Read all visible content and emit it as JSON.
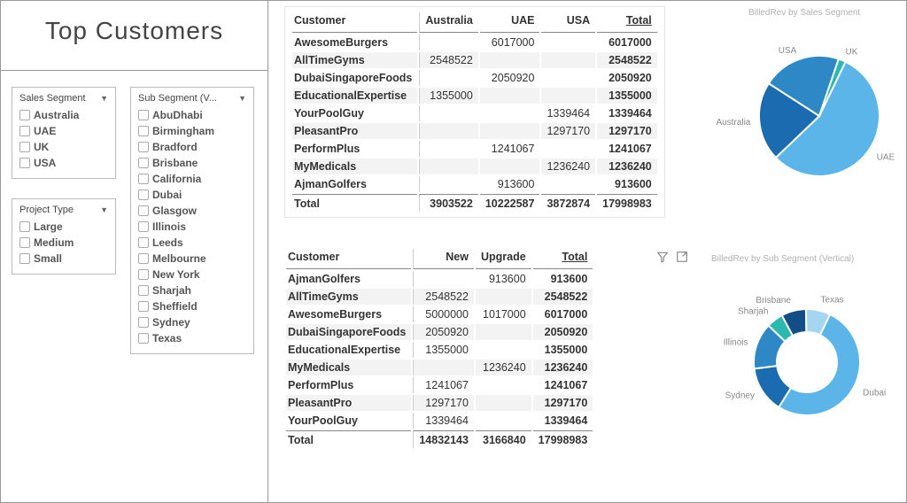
{
  "title": "Top  Customers",
  "slicers": {
    "sales_segment": {
      "header": "Sales Segment",
      "items": [
        "Australia",
        "UAE",
        "UK",
        "USA"
      ]
    },
    "project_type": {
      "header": "Project Type",
      "items": [
        "Large",
        "Medium",
        "Small"
      ]
    },
    "sub_segment": {
      "header": "Sub Segment (V...",
      "items": [
        "AbuDhabi",
        "Birmingham",
        "Bradford",
        "Brisbane",
        "California",
        "Dubai",
        "Glasgow",
        "Illinois",
        "Leeds",
        "Melbourne",
        "New York",
        "Sharjah",
        "Sheffield",
        "Sydney",
        "Texas"
      ]
    }
  },
  "matrix_top": {
    "header_customer": "Customer",
    "cols": [
      "Australia",
      "UAE",
      "USA",
      "Total"
    ],
    "rows": [
      {
        "c": "AwesomeBurgers",
        "v": [
          "",
          "6017000",
          "",
          "6017000"
        ]
      },
      {
        "c": "AllTimeGyms",
        "v": [
          "2548522",
          "",
          "",
          "2548522"
        ]
      },
      {
        "c": "DubaiSingaporeFoods",
        "v": [
          "",
          "2050920",
          "",
          "2050920"
        ]
      },
      {
        "c": "EducationalExpertise",
        "v": [
          "1355000",
          "",
          "",
          "1355000"
        ]
      },
      {
        "c": "YourPoolGuy",
        "v": [
          "",
          "",
          "1339464",
          "1339464"
        ]
      },
      {
        "c": "PleasantPro",
        "v": [
          "",
          "",
          "1297170",
          "1297170"
        ]
      },
      {
        "c": "PerformPlus",
        "v": [
          "",
          "1241067",
          "",
          "1241067"
        ]
      },
      {
        "c": "MyMedicals",
        "v": [
          "",
          "",
          "1236240",
          "1236240"
        ]
      },
      {
        "c": "AjmanGolfers",
        "v": [
          "",
          "913600",
          "",
          "913600"
        ]
      }
    ],
    "total_label": "Total",
    "totals": [
      "3903522",
      "10222587",
      "3872874",
      "17998983"
    ]
  },
  "matrix_bottom": {
    "header_customer": "Customer",
    "cols": [
      "New",
      "Upgrade",
      "Total"
    ],
    "rows": [
      {
        "c": "AjmanGolfers",
        "v": [
          "",
          "913600",
          "913600"
        ]
      },
      {
        "c": "AllTimeGyms",
        "v": [
          "2548522",
          "",
          "2548522"
        ]
      },
      {
        "c": "AwesomeBurgers",
        "v": [
          "5000000",
          "1017000",
          "6017000"
        ]
      },
      {
        "c": "DubaiSingaporeFoods",
        "v": [
          "2050920",
          "",
          "2050920"
        ]
      },
      {
        "c": "EducationalExpertise",
        "v": [
          "1355000",
          "",
          "1355000"
        ]
      },
      {
        "c": "MyMedicals",
        "v": [
          "",
          "1236240",
          "1236240"
        ]
      },
      {
        "c": "PerformPlus",
        "v": [
          "1241067",
          "",
          "1241067"
        ]
      },
      {
        "c": "PleasantPro",
        "v": [
          "1297170",
          "",
          "1297170"
        ]
      },
      {
        "c": "YourPoolGuy",
        "v": [
          "1339464",
          "",
          "1339464"
        ]
      }
    ],
    "total_label": "Total",
    "totals": [
      "14832143",
      "3166840",
      "17998983"
    ]
  },
  "chart_titles": {
    "pie1": "BilledRev by Sales Segment",
    "pie2": "BilledRev by Sub Segment (Vertical)"
  },
  "chart_data": [
    {
      "type": "pie",
      "title": "BilledRev by Sales Segment",
      "categories": [
        "UAE",
        "Australia",
        "USA",
        "UK"
      ],
      "values": [
        10222587,
        3903522,
        3872874,
        0
      ],
      "colors": [
        "#5bb5e8",
        "#1a6baf",
        "#2d88c5",
        "#2cb9ad"
      ],
      "labels": [
        "UAE",
        "Australia",
        "USA",
        "UK"
      ]
    },
    {
      "type": "donut",
      "title": "BilledRev by Sub Segment (Vertical)",
      "categories": [
        "Dubai",
        "Sydney",
        "Illinois",
        "Sharjah",
        "Brisbane",
        "Texas"
      ],
      "values": [
        9309000,
        2548522,
        2533410,
        913600,
        1355000,
        1339464
      ],
      "colors": [
        "#5bb5e8",
        "#1a6baf",
        "#2d88c5",
        "#2cb9ad",
        "#134e86",
        "#a4d6f1"
      ],
      "labels": [
        "Dubai",
        "Sydney",
        "Illinois",
        "Sharjah",
        "Brisbane",
        "Texas"
      ]
    }
  ]
}
